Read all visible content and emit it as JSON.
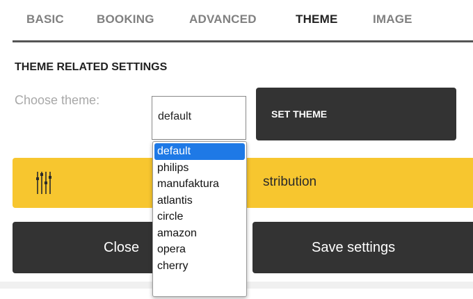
{
  "tabs": [
    {
      "label": "BASIC",
      "active": false
    },
    {
      "label": "BOOKING",
      "active": false
    },
    {
      "label": "ADVANCED",
      "active": false
    },
    {
      "label": "THEME",
      "active": true
    },
    {
      "label": "IMAGE",
      "active": false
    }
  ],
  "section": {
    "title": "THEME RELATED SETTINGS"
  },
  "theme_select": {
    "label": "Choose theme:",
    "value": "default",
    "options": [
      "default",
      "philips",
      "manufaktura",
      "atlantis",
      "circle",
      "amazon",
      "opera",
      "cherry"
    ],
    "selected_index": 0
  },
  "buttons": {
    "set_theme": "SET THEME",
    "close_partial": "Close",
    "save": "Save settings"
  },
  "distribution_bar": {
    "visible_text": "stribution",
    "icon": "equalizer-icon"
  },
  "colors": {
    "dark_button": "#333333",
    "accent_yellow": "#f7c62f",
    "selection_blue": "#1e79e6",
    "inactive_tab": "#808080"
  }
}
